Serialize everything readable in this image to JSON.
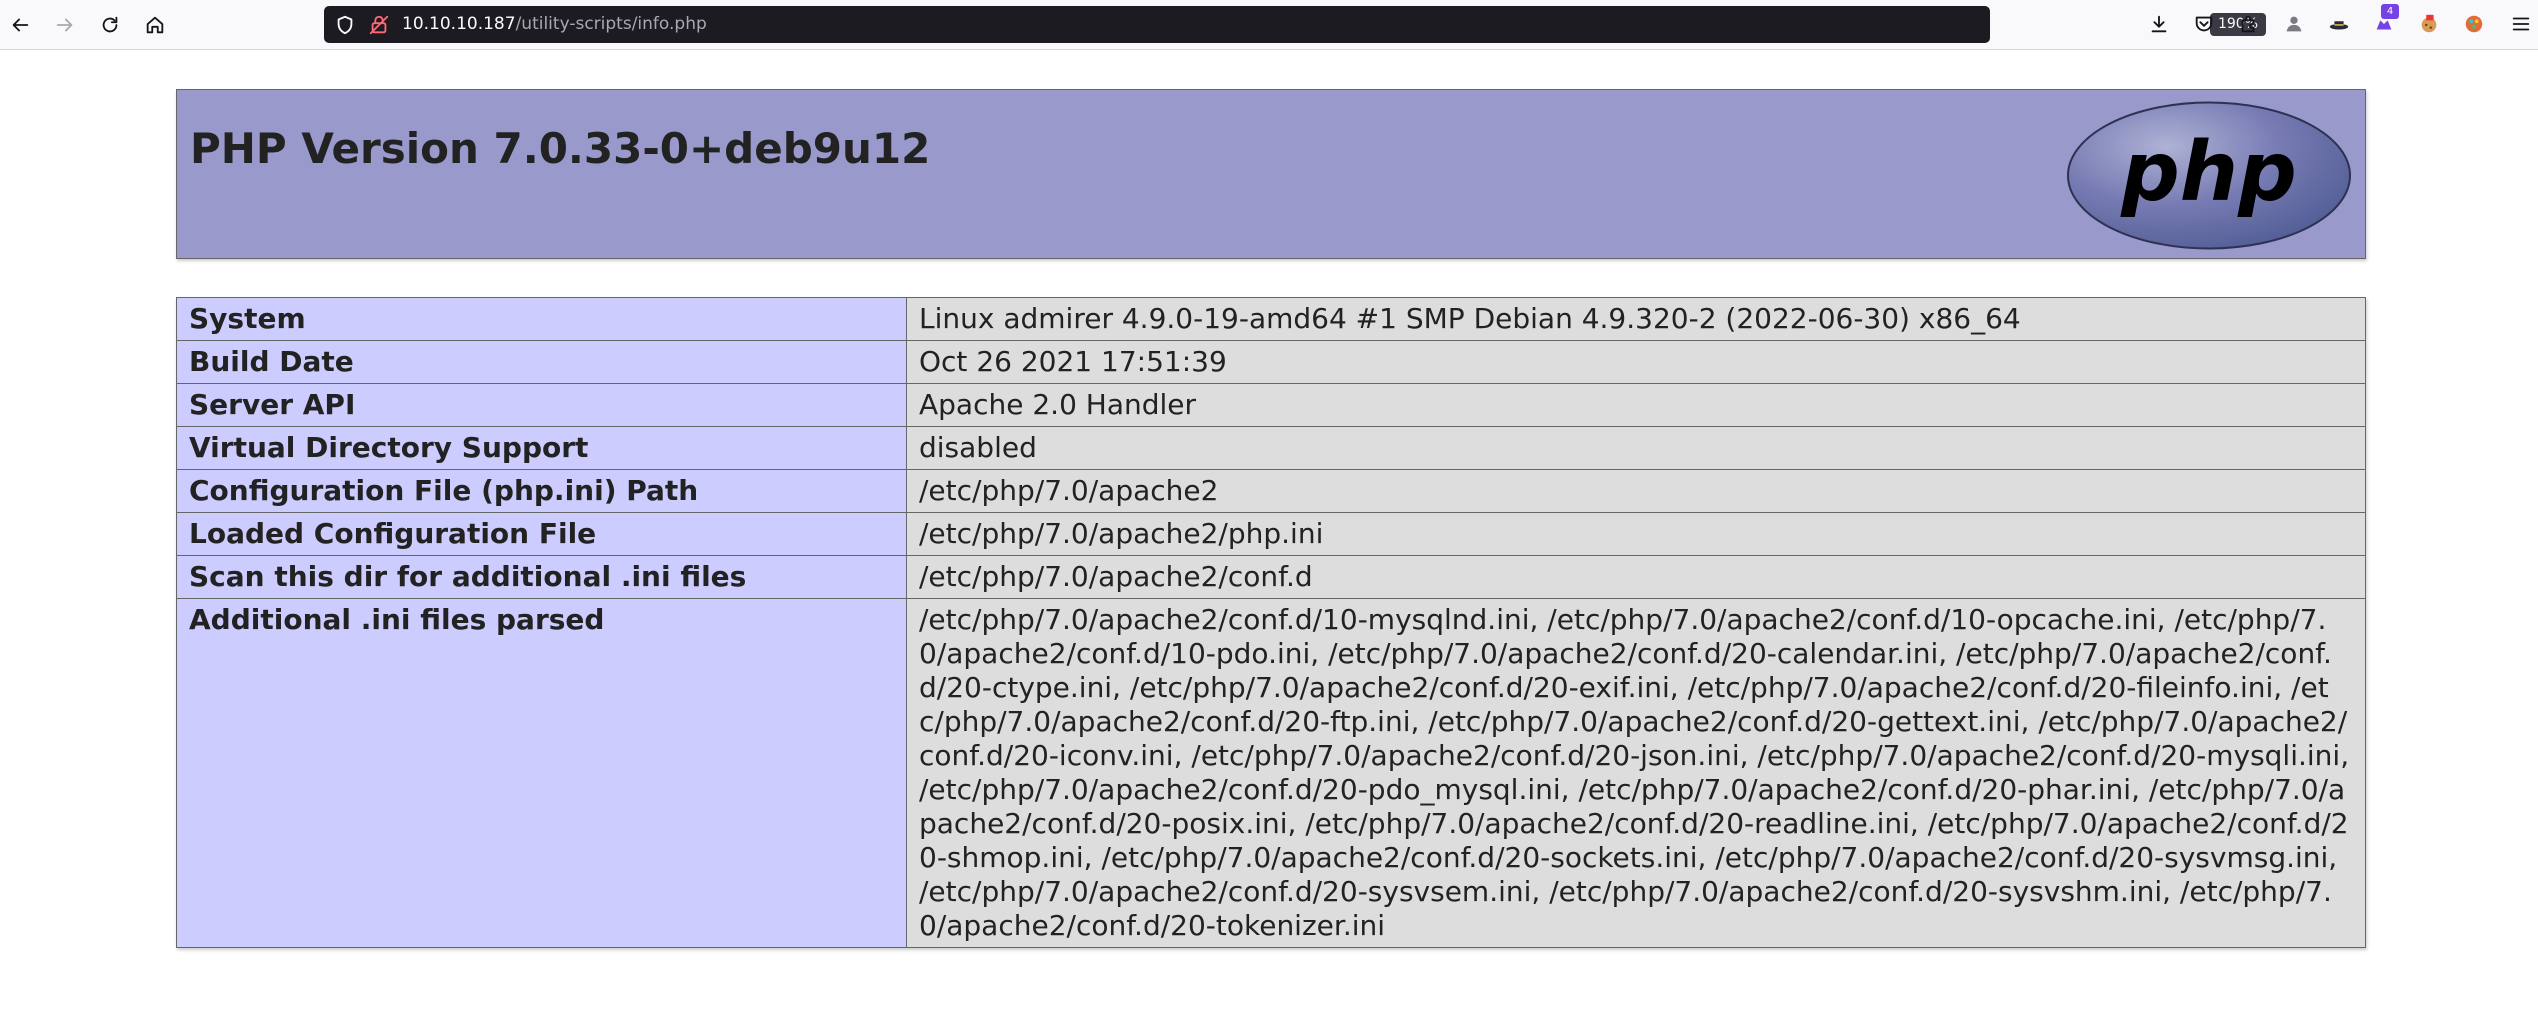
{
  "browser": {
    "url_host": "10.10.10.187",
    "url_path": "/utility-scripts/info.php",
    "zoom": "190%",
    "notification_count": "4",
    "colors": {
      "toolbar_bg": "#f9f9fb",
      "urlbar_bg": "#1c1b22",
      "lock_insecure": "#ff6a75"
    }
  },
  "page": {
    "title": "PHP Version 7.0.33-0+deb9u12",
    "logo_text": "php",
    "colors": {
      "header_bg": "#9999cc",
      "key_cell_bg": "#ccccff",
      "value_cell_bg": "#dddddd"
    },
    "rows": [
      {
        "key": "System",
        "value": "Linux admirer 4.9.0-19-amd64 #1 SMP Debian 4.9.320-2 (2022-06-30) x86_64"
      },
      {
        "key": "Build Date",
        "value": "Oct 26 2021 17:51:39"
      },
      {
        "key": "Server API",
        "value": "Apache 2.0 Handler"
      },
      {
        "key": "Virtual Directory Support",
        "value": "disabled"
      },
      {
        "key": "Configuration File (php.ini) Path",
        "value": "/etc/php/7.0/apache2"
      },
      {
        "key": "Loaded Configuration File",
        "value": "/etc/php/7.0/apache2/php.ini"
      },
      {
        "key": "Scan this dir for additional .ini files",
        "value": "/etc/php/7.0/apache2/conf.d"
      },
      {
        "key": "Additional .ini files parsed",
        "value": "/etc/php/7.0/apache2/conf.d/10-mysqlnd.ini, /etc/php/7.0/apache2/conf.d/10-opcache.ini, /etc/php/7.0/apache2/conf.d/10-pdo.ini, /etc/php/7.0/apache2/conf.d/20-calendar.ini, /etc/php/7.0/apache2/conf.d/20-ctype.ini, /etc/php/7.0/apache2/conf.d/20-exif.ini, /etc/php/7.0/apache2/conf.d/20-fileinfo.ini, /etc/php/7.0/apache2/conf.d/20-ftp.ini, /etc/php/7.0/apache2/conf.d/20-gettext.ini, /etc/php/7.0/apache2/conf.d/20-iconv.ini, /etc/php/7.0/apache2/conf.d/20-json.ini, /etc/php/7.0/apache2/conf.d/20-mysqli.ini, /etc/php/7.0/apache2/conf.d/20-pdo_mysql.ini, /etc/php/7.0/apache2/conf.d/20-phar.ini, /etc/php/7.0/apache2/conf.d/20-posix.ini, /etc/php/7.0/apache2/conf.d/20-readline.ini, /etc/php/7.0/apache2/conf.d/20-shmop.ini, /etc/php/7.0/apache2/conf.d/20-sockets.ini, /etc/php/7.0/apache2/conf.d/20-sysvmsg.ini, /etc/php/7.0/apache2/conf.d/20-sysvsem.ini, /etc/php/7.0/apache2/conf.d/20-sysvshm.ini, /etc/php/7.0/apache2/conf.d/20-tokenizer.ini"
      }
    ]
  }
}
